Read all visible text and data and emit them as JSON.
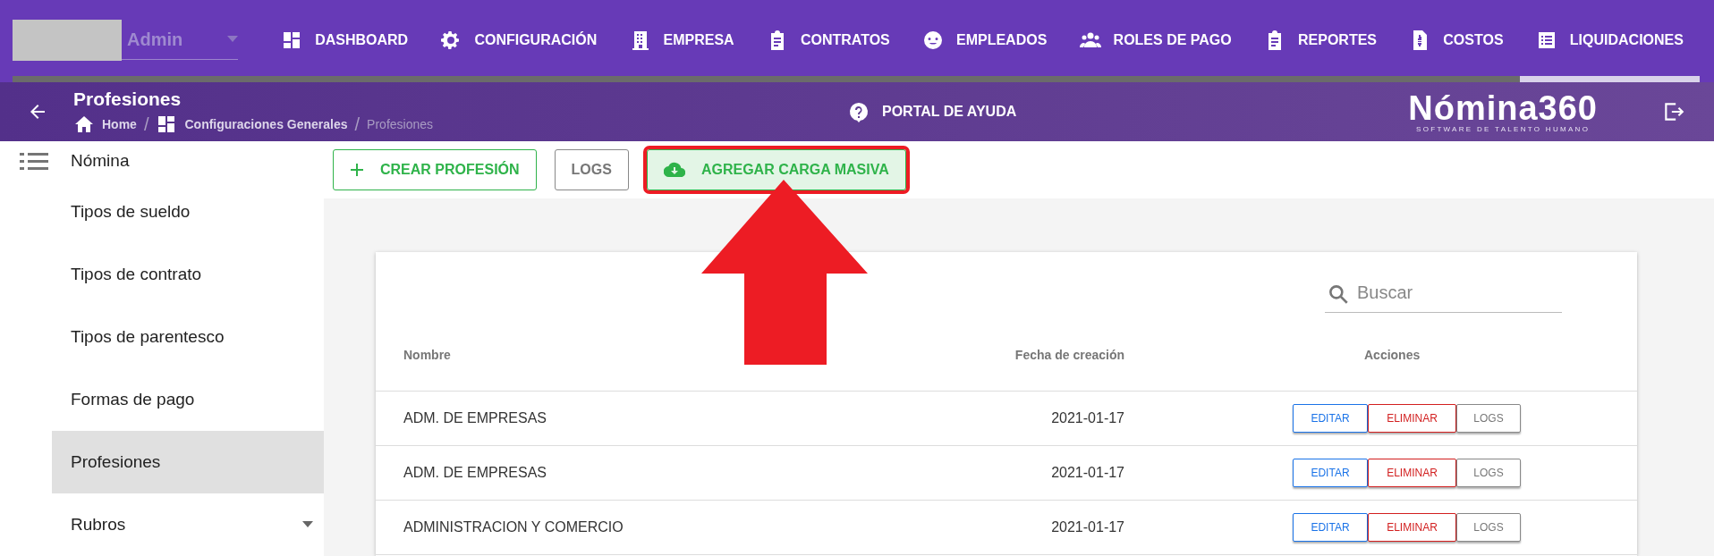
{
  "user": {
    "name": "Admin"
  },
  "nav": [
    {
      "label": "DASHBOARD",
      "selected": false
    },
    {
      "label": "CONFIGURACIÓN",
      "selected": false
    },
    {
      "label": "EMPRESA",
      "selected": false
    },
    {
      "label": "CONTRATOS",
      "selected": false
    },
    {
      "label": "EMPLEADOS",
      "selected": false
    },
    {
      "label": "ROLES DE PAGO",
      "selected": false
    },
    {
      "label": "REPORTES",
      "selected": false
    },
    {
      "label": "COSTOS",
      "selected": false
    },
    {
      "label": "LIQUIDACIONES",
      "selected": true
    }
  ],
  "header": {
    "title": "Profesiones",
    "breadcrumb": [
      "Home",
      "Configuraciones Generales",
      "Profesiones"
    ],
    "breadcrumb_separators": [
      "/",
      "/"
    ],
    "help": "PORTAL DE AYUDA",
    "logo": "Nómina360",
    "logo_tagline": "SOFTWARE DE TALENTO HUMANO"
  },
  "sidebar": {
    "items": [
      {
        "label": "Nómina",
        "kind": "group",
        "selected": false
      },
      {
        "label": "Tipos de sueldo",
        "kind": "item",
        "selected": false
      },
      {
        "label": "Tipos de contrato",
        "kind": "item",
        "selected": false
      },
      {
        "label": "Tipos de parentesco",
        "kind": "item",
        "selected": false
      },
      {
        "label": "Formas de pago",
        "kind": "item",
        "selected": false
      },
      {
        "label": "Profesiones",
        "kind": "item",
        "selected": true
      },
      {
        "label": "Rubros",
        "kind": "expandable",
        "selected": false
      }
    ]
  },
  "toolbar": [
    {
      "label": "CREAR PROFESIÓN",
      "kind": "create",
      "highlighted": false
    },
    {
      "label": "LOGS",
      "kind": "plain",
      "highlighted": false
    },
    {
      "label": "AGREGAR CARGA MASIVA",
      "kind": "upload",
      "highlighted": true
    }
  ],
  "table": {
    "search": {
      "placeholder": "Buscar"
    },
    "columns": [
      "Nombre",
      "Fecha de creación",
      "Acciones"
    ],
    "rows": [
      {
        "name": "ADM. DE EMPRESAS",
        "date": "2021-01-17",
        "actions": [
          {
            "label": "EDITAR",
            "kind": "edit"
          },
          {
            "label": "ELIMINAR",
            "kind": "delete"
          },
          {
            "label": "LOGS",
            "kind": "logs"
          }
        ]
      },
      {
        "name": "ADM. DE EMPRESAS",
        "date": "2021-01-17",
        "actions": [
          {
            "label": "EDITAR",
            "kind": "edit"
          },
          {
            "label": "ELIMINAR",
            "kind": "delete"
          },
          {
            "label": "LOGS",
            "kind": "logs"
          }
        ]
      },
      {
        "name": "ADMINISTRACION Y COMERCIO",
        "date": "2021-01-17",
        "actions": [
          {
            "label": "EDITAR",
            "kind": "edit"
          },
          {
            "label": "ELIMINAR",
            "kind": "delete"
          },
          {
            "label": "LOGS",
            "kind": "logs"
          }
        ]
      }
    ]
  }
}
